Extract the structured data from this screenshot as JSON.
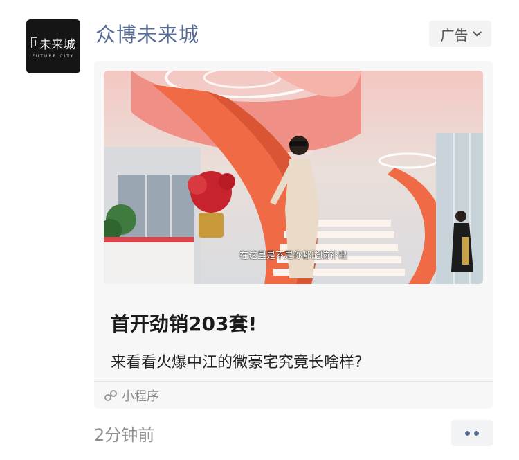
{
  "account": {
    "name": "众博未来城",
    "avatar_text": "未来城",
    "avatar_subtext": "FUTURE CITY"
  },
  "ad_badge": {
    "label": "广告"
  },
  "card": {
    "video_caption": "在这里是不是你都能脑补出",
    "headline": "首开劲销203套!",
    "subline": "来看看火爆中江的微豪宅究竟长啥样?",
    "source_label": "小程序"
  },
  "footer": {
    "timestamp": "2分钟前"
  },
  "icons": [
    "chevron-down-icon",
    "mini-program-icon",
    "more-dots-icon"
  ],
  "colors": {
    "link": "#576b95",
    "stair": "#ef6a45"
  }
}
